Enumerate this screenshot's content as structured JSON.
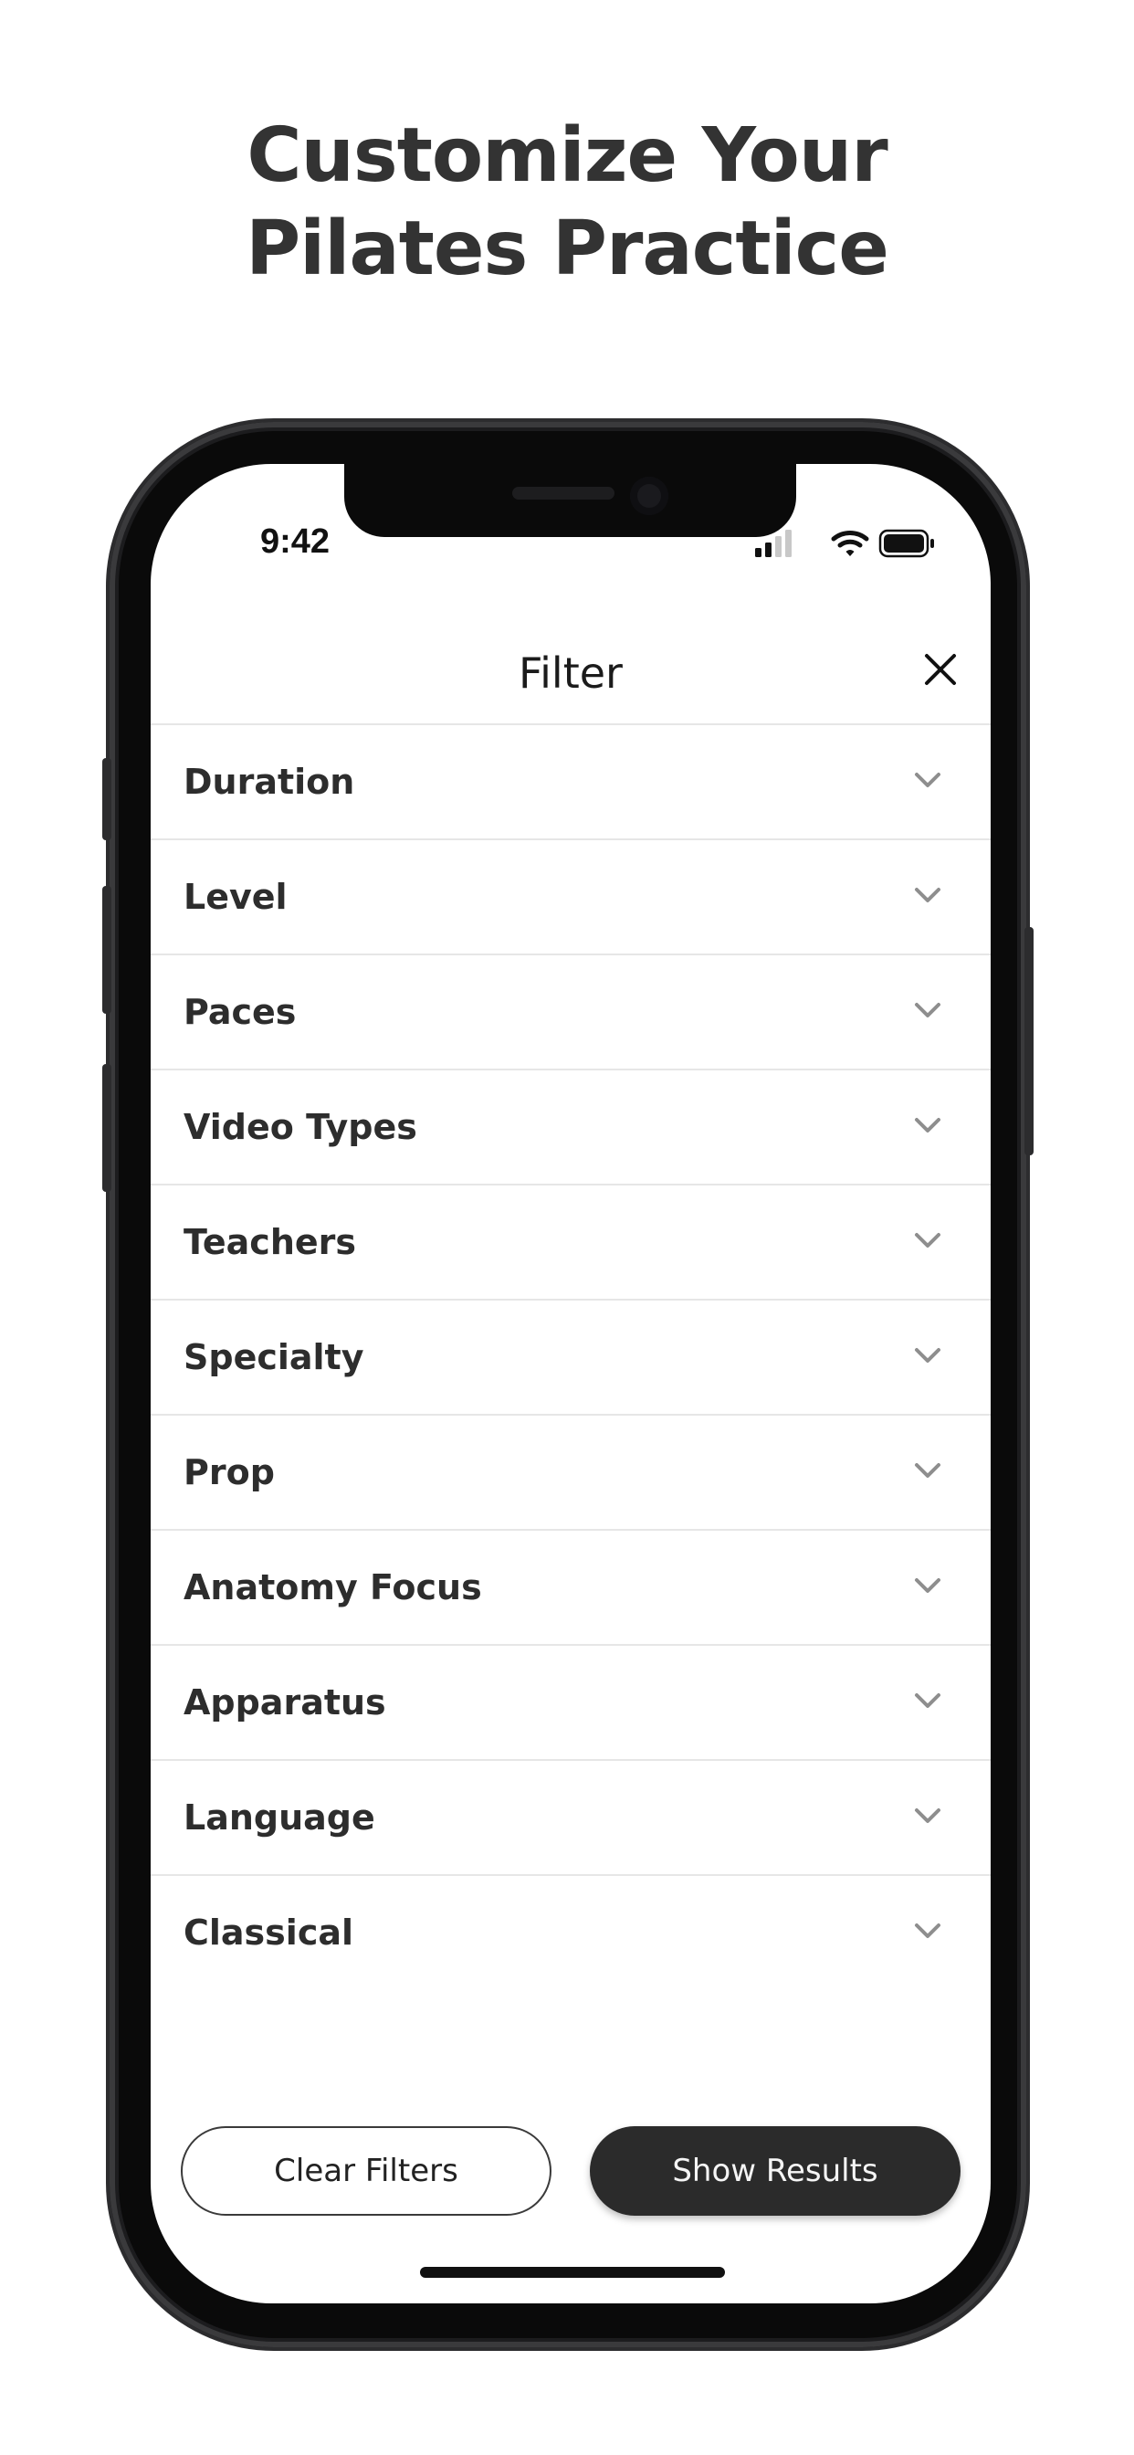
{
  "headline": {
    "line1": "Customize Your",
    "line2": "Pilates Practice"
  },
  "status_bar": {
    "time": "9:42"
  },
  "nav": {
    "title": "Filter"
  },
  "filters": [
    {
      "label": "Duration"
    },
    {
      "label": "Level"
    },
    {
      "label": "Paces"
    },
    {
      "label": "Video Types"
    },
    {
      "label": "Teachers"
    },
    {
      "label": "Specialty"
    },
    {
      "label": "Prop"
    },
    {
      "label": "Anatomy Focus"
    },
    {
      "label": "Apparatus"
    },
    {
      "label": "Language"
    },
    {
      "label": "Classical"
    }
  ],
  "actions": {
    "clear_label": "Clear Filters",
    "show_label": "Show Results"
  },
  "colors": {
    "text_dark": "#333333",
    "button_dark": "#2b2b2b",
    "divider": "#e6e6e6",
    "chevron": "#8e8e8e"
  }
}
